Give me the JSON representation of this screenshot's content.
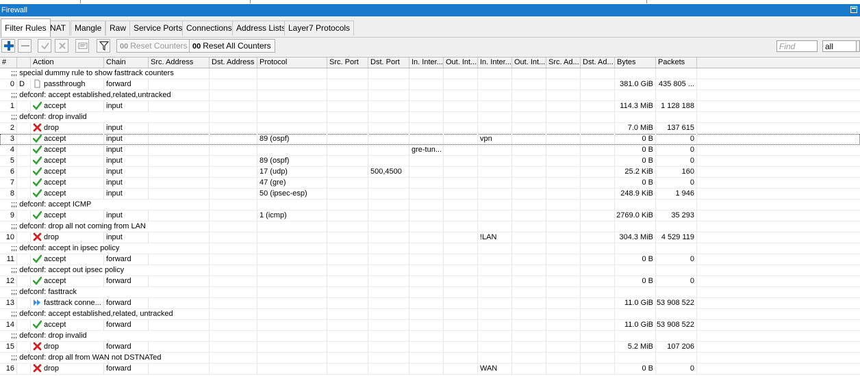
{
  "window": {
    "title": "Firewall"
  },
  "tabs": [
    "Filter Rules",
    "NAT",
    "Mangle",
    "Raw",
    "Service Ports",
    "Connections",
    "Address Lists",
    "Layer7 Protocols"
  ],
  "active_tab": "Filter Rules",
  "toolbar": {
    "reset_counters": "Reset Counters",
    "reset_all_counters": "Reset All Counters",
    "counter_glyph": "00",
    "find_placeholder": "Find",
    "filter_value": "all"
  },
  "columns": [
    "#",
    "",
    "Action",
    "Chain",
    "Src. Address",
    "Dst. Address",
    "Protocol",
    "Src. Port",
    "Dst. Port",
    "In. Inter...",
    "Out. Int...",
    "In. Inter...",
    "Out. Int...",
    "Src. Ad...",
    "Dst. Ad...",
    "Bytes",
    "Packets"
  ],
  "rows": [
    {
      "type": "comment",
      "text": ";;; special dummy rule to show fasttrack counters"
    },
    {
      "type": "rule",
      "num": "0",
      "flag": "D",
      "icon": "passthrough",
      "action": "passthrough",
      "chain": "forward",
      "protocol": "",
      "dst_port": "",
      "in_iface": "",
      "in_iface_list": "",
      "bytes": "381.0 GiB",
      "packets": "435 805 ..."
    },
    {
      "type": "comment",
      "text": ";;; defconf: accept established,related,untracked"
    },
    {
      "type": "rule",
      "num": "1",
      "flag": "",
      "icon": "accept",
      "action": "accept",
      "chain": "input",
      "protocol": "",
      "dst_port": "",
      "in_iface": "",
      "in_iface_list": "",
      "bytes": "114.3 MiB",
      "packets": "1 128 188"
    },
    {
      "type": "comment",
      "text": ";;; defconf: drop invalid"
    },
    {
      "type": "rule",
      "num": "2",
      "flag": "",
      "icon": "drop",
      "action": "drop",
      "chain": "input",
      "protocol": "",
      "dst_port": "",
      "in_iface": "",
      "in_iface_list": "",
      "bytes": "7.0 MiB",
      "packets": "137 615"
    },
    {
      "type": "rule",
      "num": "3",
      "flag": "",
      "icon": "accept",
      "action": "accept",
      "chain": "input",
      "protocol": "89 (ospf)",
      "dst_port": "",
      "in_iface": "",
      "in_iface_list": "vpn",
      "bytes": "0 B",
      "packets": "0",
      "selected": true
    },
    {
      "type": "rule",
      "num": "4",
      "flag": "",
      "icon": "accept",
      "action": "accept",
      "chain": "input",
      "protocol": "",
      "dst_port": "",
      "in_iface": "gre-tun...",
      "in_iface_list": "",
      "bytes": "0 B",
      "packets": "0"
    },
    {
      "type": "rule",
      "num": "5",
      "flag": "",
      "icon": "accept",
      "action": "accept",
      "chain": "input",
      "protocol": "89 (ospf)",
      "dst_port": "",
      "in_iface": "",
      "in_iface_list": "",
      "bytes": "0 B",
      "packets": "0"
    },
    {
      "type": "rule",
      "num": "6",
      "flag": "",
      "icon": "accept",
      "action": "accept",
      "chain": "input",
      "protocol": "17 (udp)",
      "dst_port": "500,4500",
      "in_iface": "",
      "in_iface_list": "",
      "bytes": "25.2 KiB",
      "packets": "160"
    },
    {
      "type": "rule",
      "num": "7",
      "flag": "",
      "icon": "accept",
      "action": "accept",
      "chain": "input",
      "protocol": "47 (gre)",
      "dst_port": "",
      "in_iface": "",
      "in_iface_list": "",
      "bytes": "0 B",
      "packets": "0"
    },
    {
      "type": "rule",
      "num": "8",
      "flag": "",
      "icon": "accept",
      "action": "accept",
      "chain": "input",
      "protocol": "50 (ipsec-esp)",
      "dst_port": "",
      "in_iface": "",
      "in_iface_list": "",
      "bytes": "248.9 KiB",
      "packets": "1 946"
    },
    {
      "type": "comment",
      "text": ";;; defconf: accept ICMP"
    },
    {
      "type": "rule",
      "num": "9",
      "flag": "",
      "icon": "accept",
      "action": "accept",
      "chain": "input",
      "protocol": "1 (icmp)",
      "dst_port": "",
      "in_iface": "",
      "in_iface_list": "",
      "bytes": "2769.0 KiB",
      "packets": "35 293"
    },
    {
      "type": "comment",
      "text": ";;; defconf: drop all not coming from LAN"
    },
    {
      "type": "rule",
      "num": "10",
      "flag": "",
      "icon": "drop",
      "action": "drop",
      "chain": "input",
      "protocol": "",
      "dst_port": "",
      "in_iface": "",
      "in_iface_list": "!LAN",
      "bytes": "304.3 MiB",
      "packets": "4 529 119"
    },
    {
      "type": "comment",
      "text": ";;; defconf: accept in ipsec policy"
    },
    {
      "type": "rule",
      "num": "11",
      "flag": "",
      "icon": "accept",
      "action": "accept",
      "chain": "forward",
      "protocol": "",
      "dst_port": "",
      "in_iface": "",
      "in_iface_list": "",
      "bytes": "0 B",
      "packets": "0"
    },
    {
      "type": "comment",
      "text": ";;; defconf: accept out ipsec policy"
    },
    {
      "type": "rule",
      "num": "12",
      "flag": "",
      "icon": "accept",
      "action": "accept",
      "chain": "forward",
      "protocol": "",
      "dst_port": "",
      "in_iface": "",
      "in_iface_list": "",
      "bytes": "0 B",
      "packets": "0"
    },
    {
      "type": "comment",
      "text": ";;; defconf: fasttrack"
    },
    {
      "type": "rule",
      "num": "13",
      "flag": "",
      "icon": "fasttrack",
      "action": "fasttrack conne...",
      "chain": "forward",
      "protocol": "",
      "dst_port": "",
      "in_iface": "",
      "in_iface_list": "",
      "bytes": "11.0 GiB",
      "packets": "53 908 522"
    },
    {
      "type": "comment",
      "text": ";;; defconf: accept established,related, untracked"
    },
    {
      "type": "rule",
      "num": "14",
      "flag": "",
      "icon": "accept",
      "action": "accept",
      "chain": "forward",
      "protocol": "",
      "dst_port": "",
      "in_iface": "",
      "in_iface_list": "",
      "bytes": "11.0 GiB",
      "packets": "53 908 522"
    },
    {
      "type": "comment",
      "text": ";;; defconf: drop invalid"
    },
    {
      "type": "rule",
      "num": "15",
      "flag": "",
      "icon": "drop",
      "action": "drop",
      "chain": "forward",
      "protocol": "",
      "dst_port": "",
      "in_iface": "",
      "in_iface_list": "",
      "bytes": "5.2 MiB",
      "packets": "107 206"
    },
    {
      "type": "comment",
      "text": ";;; defconf:  drop all from WAN not DSTNATed"
    },
    {
      "type": "rule",
      "num": "16",
      "flag": "",
      "icon": "drop",
      "action": "drop",
      "chain": "forward",
      "protocol": "",
      "dst_port": "",
      "in_iface": "",
      "in_iface_list": "WAN",
      "bytes": "0 B",
      "packets": "0"
    }
  ],
  "colors": {
    "titlebar": "#1979ca",
    "accept": "#2fa52f",
    "drop": "#d42020",
    "fasttrack": "#3a8ee6",
    "add": "#1565c0"
  }
}
